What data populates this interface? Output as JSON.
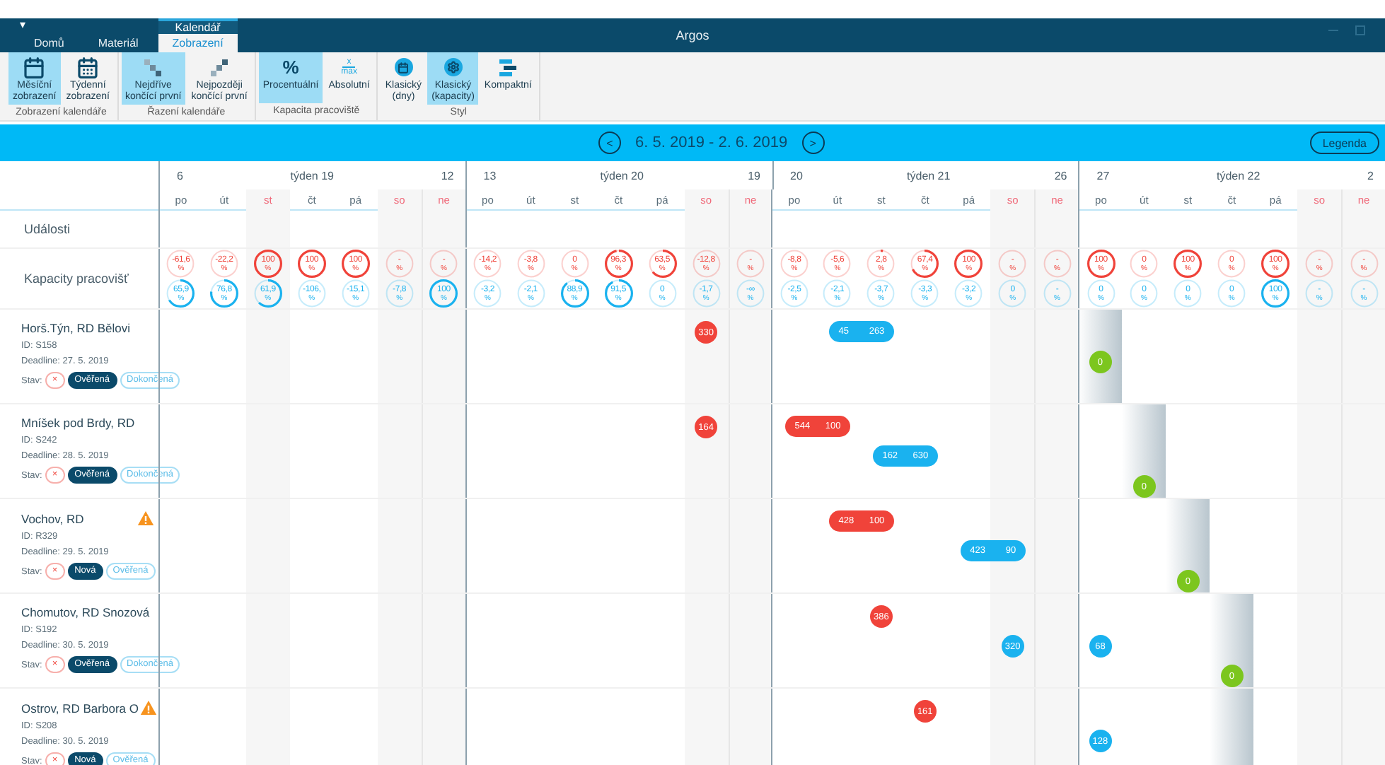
{
  "title_bar": {
    "menu_glyph": "▾",
    "title": "Argos"
  },
  "tabs": [
    {
      "label": "Domů",
      "selected": false
    },
    {
      "label": "Materiál",
      "selected": false
    },
    {
      "label": "Zobrazení",
      "selected": true,
      "context_group": "Kalendář"
    }
  ],
  "ribbon": [
    {
      "label": "Zobrazení kalendáře",
      "buttons": [
        {
          "kind": "calendar",
          "lines": [
            "Měsíční",
            "zobrazení"
          ],
          "selected": true
        },
        {
          "kind": "calendar-grid",
          "lines": [
            "Týdenní",
            "zobrazení"
          ],
          "selected": false
        }
      ]
    },
    {
      "label": "Řazení kalendáře",
      "buttons": [
        {
          "kind": "stairs-down",
          "lines": [
            "Nejdříve",
            "končící první"
          ],
          "selected": true
        },
        {
          "kind": "stairs-up",
          "lines": [
            "Nejpozději",
            "končící první"
          ],
          "selected": false
        }
      ]
    },
    {
      "label": "Kapacita pracoviště",
      "buttons": [
        {
          "kind": "symbol",
          "symbols": [
            "%"
          ],
          "lines": [
            "Procentuální"
          ],
          "selected": true
        },
        {
          "kind": "fraction",
          "symbols": [
            "x",
            "max"
          ],
          "lines": [
            "Absolutní"
          ],
          "selected": false
        }
      ]
    },
    {
      "label": "Styl",
      "buttons": [
        {
          "kind": "round-calendar",
          "lines": [
            "Klasický",
            "(dny)"
          ],
          "selected": false
        },
        {
          "kind": "round-gear",
          "lines": [
            "Klasický",
            "(kapacity)"
          ],
          "selected": true
        },
        {
          "kind": "bars",
          "lines": [
            "Kompaktní"
          ],
          "selected": false
        }
      ]
    }
  ],
  "toolbar": {
    "prev": "<",
    "date_range": "6. 5. 2019 - 2. 6. 2019",
    "next": ">",
    "legend": "Legenda"
  },
  "calendar": {
    "weeks": [
      {
        "first": "6",
        "label": "týden 19",
        "last": "12",
        "days": [
          {
            "name": "po",
            "holiday": false
          },
          {
            "name": "út",
            "holiday": false
          },
          {
            "name": "st",
            "holiday": true
          },
          {
            "name": "čt",
            "holiday": false
          },
          {
            "name": "pá",
            "holiday": false
          },
          {
            "name": "so",
            "holiday": true
          },
          {
            "name": "ne",
            "holiday": true
          }
        ]
      },
      {
        "first": "13",
        "label": "týden 20",
        "last": "19",
        "days": [
          {
            "name": "po",
            "holiday": false
          },
          {
            "name": "út",
            "holiday": false
          },
          {
            "name": "st",
            "holiday": false
          },
          {
            "name": "čt",
            "holiday": false
          },
          {
            "name": "pá",
            "holiday": false
          },
          {
            "name": "so",
            "holiday": true
          },
          {
            "name": "ne",
            "holiday": true
          }
        ]
      },
      {
        "first": "20",
        "label": "týden 21",
        "last": "26",
        "days": [
          {
            "name": "po",
            "holiday": false
          },
          {
            "name": "út",
            "holiday": false
          },
          {
            "name": "st",
            "holiday": false
          },
          {
            "name": "čt",
            "holiday": false
          },
          {
            "name": "pá",
            "holiday": false
          },
          {
            "name": "so",
            "holiday": true
          },
          {
            "name": "ne",
            "holiday": true
          }
        ]
      },
      {
        "first": "27",
        "label": "týden 22",
        "last": "2",
        "days": [
          {
            "name": "po",
            "holiday": false
          },
          {
            "name": "út",
            "holiday": false
          },
          {
            "name": "st",
            "holiday": false
          },
          {
            "name": "čt",
            "holiday": false
          },
          {
            "name": "pá",
            "holiday": false
          },
          {
            "name": "so",
            "holiday": true
          },
          {
            "name": "ne",
            "holiday": true
          }
        ]
      }
    ],
    "events_label": "Události",
    "capacities": {
      "label": "Kapacity pracovišť",
      "rows": [
        {
          "color": "#f0433a",
          "cells": [
            {
              "value": "-61,6",
              "unit": "%"
            },
            {
              "value": "-22,2",
              "unit": "%"
            },
            {
              "value": "100",
              "unit": "%"
            },
            {
              "value": "100",
              "unit": "%"
            },
            {
              "value": "100",
              "unit": "%"
            },
            {
              "value": "-",
              "unit": "%"
            },
            {
              "value": "-",
              "unit": "%"
            },
            {
              "value": "-14,2",
              "unit": "%"
            },
            {
              "value": "-3,8",
              "unit": "%"
            },
            {
              "value": "0",
              "unit": "%"
            },
            {
              "value": "96,3",
              "unit": "%"
            },
            {
              "value": "63,5",
              "unit": "%"
            },
            {
              "value": "-12,8",
              "unit": "%"
            },
            {
              "value": "-",
              "unit": "%"
            },
            {
              "value": "-8,8",
              "unit": "%"
            },
            {
              "value": "-5,6",
              "unit": "%"
            },
            {
              "value": "2,8",
              "unit": "%"
            },
            {
              "value": "67,4",
              "unit": "%"
            },
            {
              "value": "100",
              "unit": "%"
            },
            {
              "value": "-",
              "unit": "%"
            },
            {
              "value": "-",
              "unit": "%"
            },
            {
              "value": "100",
              "unit": "%"
            },
            {
              "value": "0",
              "unit": "%"
            },
            {
              "value": "100",
              "unit": "%"
            },
            {
              "value": "0",
              "unit": "%"
            },
            {
              "value": "100",
              "unit": "%"
            },
            {
              "value": "-",
              "unit": "%"
            },
            {
              "value": "-",
              "unit": "%"
            }
          ]
        },
        {
          "color": "#1ab2ef",
          "cells": [
            {
              "value": "65,9",
              "unit": "%"
            },
            {
              "value": "76,8",
              "unit": "%"
            },
            {
              "value": "61,9",
              "unit": "%"
            },
            {
              "value": "-106,",
              "unit": "%"
            },
            {
              "value": "-15,1",
              "unit": "%"
            },
            {
              "value": "-7,8",
              "unit": "%"
            },
            {
              "value": "100",
              "unit": "%"
            },
            {
              "value": "-3,2",
              "unit": "%"
            },
            {
              "value": "-2,1",
              "unit": "%"
            },
            {
              "value": "88,9",
              "unit": "%"
            },
            {
              "value": "91,5",
              "unit": "%"
            },
            {
              "value": "0",
              "unit": "%"
            },
            {
              "value": "-1,7",
              "unit": "%"
            },
            {
              "value": "-∞",
              "unit": "%"
            },
            {
              "value": "-2,5",
              "unit": "%"
            },
            {
              "value": "-2,1",
              "unit": "%"
            },
            {
              "value": "-3,7",
              "unit": "%"
            },
            {
              "value": "-3,3",
              "unit": "%"
            },
            {
              "value": "-3,2",
              "unit": "%"
            },
            {
              "value": "0",
              "unit": "%"
            },
            {
              "value": "-",
              "unit": "%"
            },
            {
              "value": "0",
              "unit": "%"
            },
            {
              "value": "0",
              "unit": "%"
            },
            {
              "value": "0",
              "unit": "%"
            },
            {
              "value": "0",
              "unit": "%"
            },
            {
              "value": "100",
              "unit": "%"
            },
            {
              "value": "-",
              "unit": "%"
            },
            {
              "value": "-",
              "unit": "%"
            }
          ]
        }
      ]
    }
  },
  "projects": [
    {
      "name": "Horš.Týn, RD Bělovi",
      "warning": false,
      "id": "ID: S158",
      "deadline": "Deadline: 27. 5. 2019",
      "status_label": "Stav:",
      "status": [
        {
          "kind": "cancel",
          "label": "×"
        },
        {
          "kind": "state",
          "label": "Ověřená",
          "selected": true
        },
        {
          "kind": "state",
          "label": "Dokončená",
          "selected": false
        }
      ],
      "lanes": [
        [
          {
            "kind": "dot",
            "color": "#f0433a",
            "labels": [
              "330"
            ]
          },
          {
            "kind": "bar",
            "color": "#1ab2ef",
            "labels": [
              "45",
              "263"
            ]
          }
        ],
        [
          {
            "kind": "dot",
            "color": "#7cc61e",
            "labels": [
              "0"
            ]
          }
        ]
      ]
    },
    {
      "name": "Mníšek pod Brdy, RD",
      "warning": false,
      "id": "ID: S242",
      "deadline": "Deadline: 28. 5. 2019",
      "status_label": "Stav:",
      "status": [
        {
          "kind": "cancel",
          "label": "×"
        },
        {
          "kind": "state",
          "label": "Ověřená",
          "selected": true
        },
        {
          "kind": "state",
          "label": "Dokončená",
          "selected": false
        }
      ],
      "lanes": [
        [
          {
            "kind": "dot",
            "color": "#f0433a",
            "labels": [
              "164"
            ]
          },
          {
            "kind": "bar",
            "color": "#f0433a",
            "labels": [
              "544",
              "100"
            ]
          }
        ],
        [
          {
            "kind": "bar",
            "color": "#1ab2ef",
            "labels": [
              "162",
              "630"
            ]
          }
        ],
        [
          {
            "kind": "dot",
            "color": "#7cc61e",
            "labels": [
              "0"
            ]
          }
        ]
      ]
    },
    {
      "name": "Vochov, RD",
      "warning": true,
      "id": "ID: R329",
      "deadline": "Deadline: 29. 5. 2019",
      "status_label": "Stav:",
      "status": [
        {
          "kind": "cancel",
          "label": "×"
        },
        {
          "kind": "state",
          "label": "Nová",
          "selected": true
        },
        {
          "kind": "state",
          "label": "Ověřená",
          "selected": false
        }
      ],
      "lanes": [
        [
          {
            "kind": "bar",
            "color": "#f0433a",
            "labels": [
              "428",
              "100"
            ]
          }
        ],
        [
          {
            "kind": "bar",
            "color": "#1ab2ef",
            "labels": [
              "423",
              "90"
            ]
          }
        ],
        [
          {
            "kind": "dot",
            "color": "#7cc61e",
            "labels": [
              "0"
            ]
          }
        ]
      ]
    },
    {
      "name": "Chomutov, RD Snozová",
      "warning": false,
      "id": "ID: S192",
      "deadline": "Deadline: 30. 5. 2019",
      "status_label": "Stav:",
      "status": [
        {
          "kind": "cancel",
          "label": "×"
        },
        {
          "kind": "state",
          "label": "Ověřená",
          "selected": true
        },
        {
          "kind": "state",
          "label": "Dokončená",
          "selected": false
        }
      ],
      "lanes": [
        [
          {
            "kind": "dot",
            "color": "#f0433a",
            "labels": [
              "386"
            ]
          }
        ],
        [
          {
            "kind": "dot",
            "color": "#1ab2ef",
            "labels": [
              "320"
            ]
          },
          {
            "kind": "dot",
            "color": "#1ab2ef",
            "labels": [
              "68"
            ]
          }
        ],
        [
          {
            "kind": "dot",
            "color": "#7cc61e",
            "labels": [
              "0"
            ]
          }
        ]
      ]
    },
    {
      "name": "Ostrov, RD Barbora O",
      "warning": true,
      "id": "ID: S208",
      "deadline": "Deadline: 30. 5. 2019",
      "status_label": "Stav:",
      "status": [
        {
          "kind": "cancel",
          "label": "×"
        },
        {
          "kind": "state",
          "label": "Nová",
          "selected": true
        },
        {
          "kind": "state",
          "label": "Ověřená",
          "selected": false
        }
      ],
      "lanes": [
        [
          {
            "kind": "dot",
            "color": "#f0433a",
            "labels": [
              "161"
            ]
          }
        ],
        [
          {
            "kind": "dot",
            "color": "#1ab2ef",
            "labels": [
              "128"
            ]
          }
        ]
      ]
    }
  ]
}
